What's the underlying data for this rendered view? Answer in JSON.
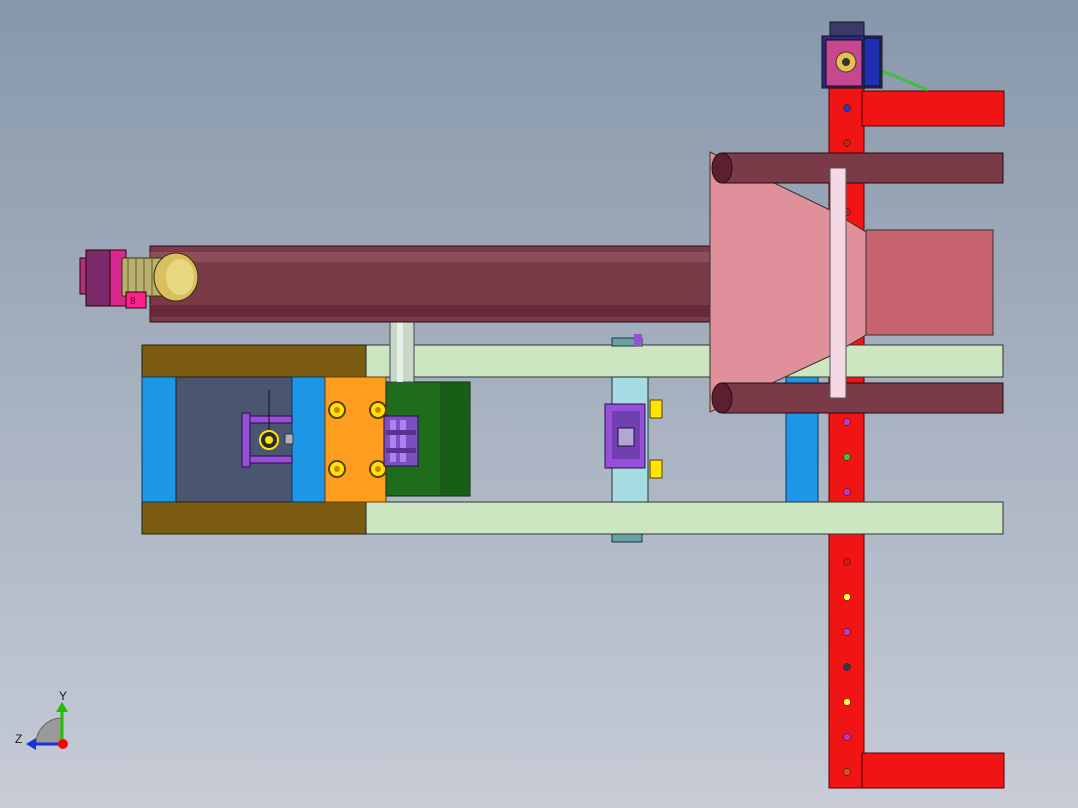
{
  "viewport": {
    "background_top": "#8797ab",
    "background_bottom": "#c7ccd6"
  },
  "triad": {
    "y_label": "Y",
    "z_label": "Z",
    "colors": {
      "y": "#22c000",
      "z": "#1830e0",
      "origin": "#ff0000"
    }
  },
  "palette": {
    "red_frame": "#f01414",
    "maroon_tube": "#7a3a48",
    "pink_hopper": "#e0909a",
    "rose_box": "#c86470",
    "light_green_rail": "#cde6c2",
    "olive_block": "#7c5c10",
    "blue_plate": "#1e96e6",
    "slate_plate": "#4a5570",
    "orange_plate": "#ff9d1e",
    "dark_green_drum": "#1f6d1a",
    "purple_part": "#9650d8",
    "yellow_nut": "#ffe400",
    "motor_yellow": "#d8c060",
    "magenta_part": "#d82890",
    "cyan_bracket": "#a8dce4",
    "light_pink_slider": "#f4d8e4"
  },
  "holes": [
    "#2040c0",
    "#c02020",
    "#c02020",
    "#b040c0",
    "#40c040",
    "#b040c0",
    "#c02020",
    "#ffff40",
    "#b040c0",
    "#204060",
    "#ffff40",
    "#b040c0",
    "#c06020"
  ],
  "icons": [
    "gear-reducer-icon",
    "motor-icon",
    "bolt-icon"
  ]
}
